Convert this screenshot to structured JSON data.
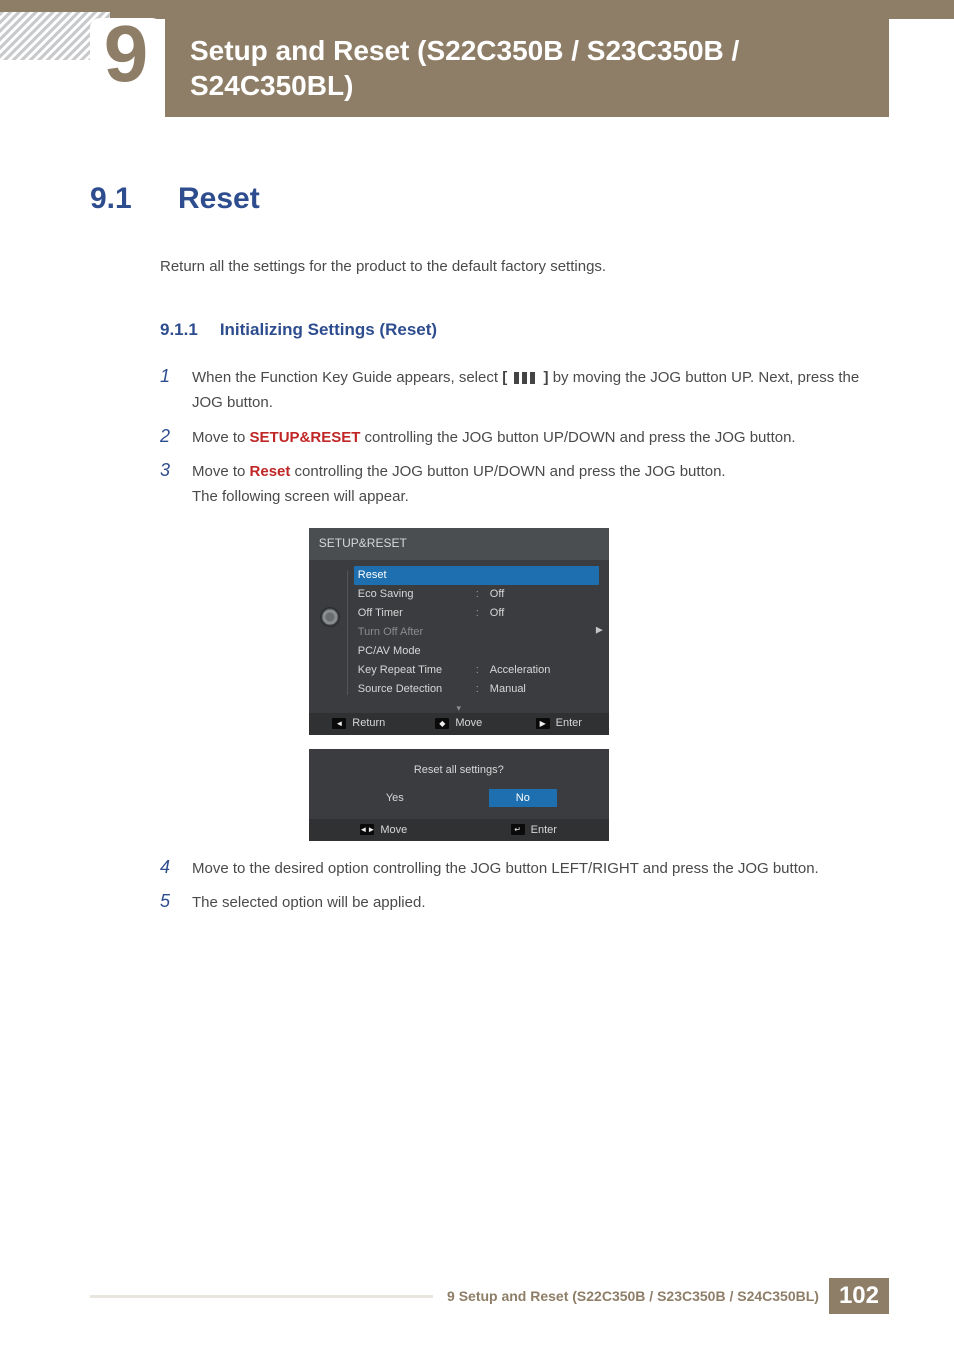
{
  "chapter": {
    "number": "9",
    "title": "Setup and Reset (S22C350B / S23C350B / S24C350BL)"
  },
  "section": {
    "number": "9.1",
    "title": "Reset",
    "intro": "Return all the settings for the product to the default factory settings."
  },
  "subsection": {
    "number": "9.1.1",
    "title": "Initializing Settings (Reset)"
  },
  "steps": {
    "s1a": "When the Function Key Guide appears, select ",
    "s1b": " by moving the JOG button UP. Next, press the JOG button.",
    "s2a": "Move to ",
    "s2kw": "SETUP&RESET",
    "s2b": " controlling the JOG button UP/DOWN and press the JOG button.",
    "s3a": "Move to ",
    "s3kw": "Reset",
    "s3b": " controlling the JOG button UP/DOWN and press the JOG button.",
    "s3c": "The following screen will appear.",
    "s4": "Move to the desired option controlling the JOG button LEFT/RIGHT and press the JOG button.",
    "s5": "The selected option will be applied."
  },
  "osd": {
    "title": "SETUP&RESET",
    "rows": [
      {
        "label": "Reset",
        "value": "",
        "selected": true
      },
      {
        "label": "Eco Saving",
        "value": "Off"
      },
      {
        "label": "Off Timer",
        "value": "Off"
      },
      {
        "label": "Turn Off After",
        "value": "",
        "disabled": true
      },
      {
        "label": "PC/AV Mode",
        "value": ""
      },
      {
        "label": "Key Repeat Time",
        "value": "Acceleration"
      },
      {
        "label": "Source Detection",
        "value": "Manual"
      }
    ],
    "hints": {
      "return": "Return",
      "move": "Move",
      "enter": "Enter"
    }
  },
  "dialog": {
    "question": "Reset all settings?",
    "yes": "Yes",
    "no": "No",
    "hints": {
      "move": "Move",
      "enter": "Enter"
    }
  },
  "footer": {
    "text": "9 Setup and Reset (S22C350B / S23C350B / S24C350BL)",
    "page": "102"
  }
}
